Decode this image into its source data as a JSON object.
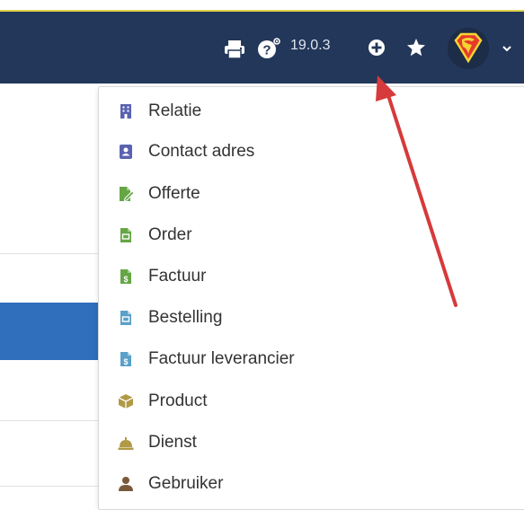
{
  "header": {
    "version": "19.0.3",
    "icons": [
      "printer-icon",
      "help-icon",
      "plus-circle-icon",
      "star-icon",
      "avatar",
      "chevron-down-icon"
    ]
  },
  "menu": {
    "items": [
      {
        "label": "Relatie",
        "icon": "building-icon",
        "color": "#5a62b0"
      },
      {
        "label": "Contact adres",
        "icon": "address-card-icon",
        "color": "#5a62b0"
      },
      {
        "label": "Offerte",
        "icon": "file-signature-icon",
        "color": "#65a545"
      },
      {
        "label": "Order",
        "icon": "file-order-icon",
        "color": "#65a545"
      },
      {
        "label": "Factuur",
        "icon": "file-invoice-dollar-icon",
        "color": "#65a545"
      },
      {
        "label": "Bestelling",
        "icon": "file-purchase-icon",
        "color": "#5aa0c8"
      },
      {
        "label": "Factuur leverancier",
        "icon": "file-invoice-dollar-icon",
        "color": "#5aa0c8"
      },
      {
        "label": "Product",
        "icon": "cube-icon",
        "color": "#b09a45"
      },
      {
        "label": "Dienst",
        "icon": "concierge-bell-icon",
        "color": "#b09a45"
      },
      {
        "label": "Gebruiker",
        "icon": "user-icon",
        "color": "#7a5a3a"
      }
    ]
  },
  "colors": {
    "navbar": "#23375a",
    "accent_line": "#e1d24a",
    "annotation_arrow": "#d63a3a"
  }
}
